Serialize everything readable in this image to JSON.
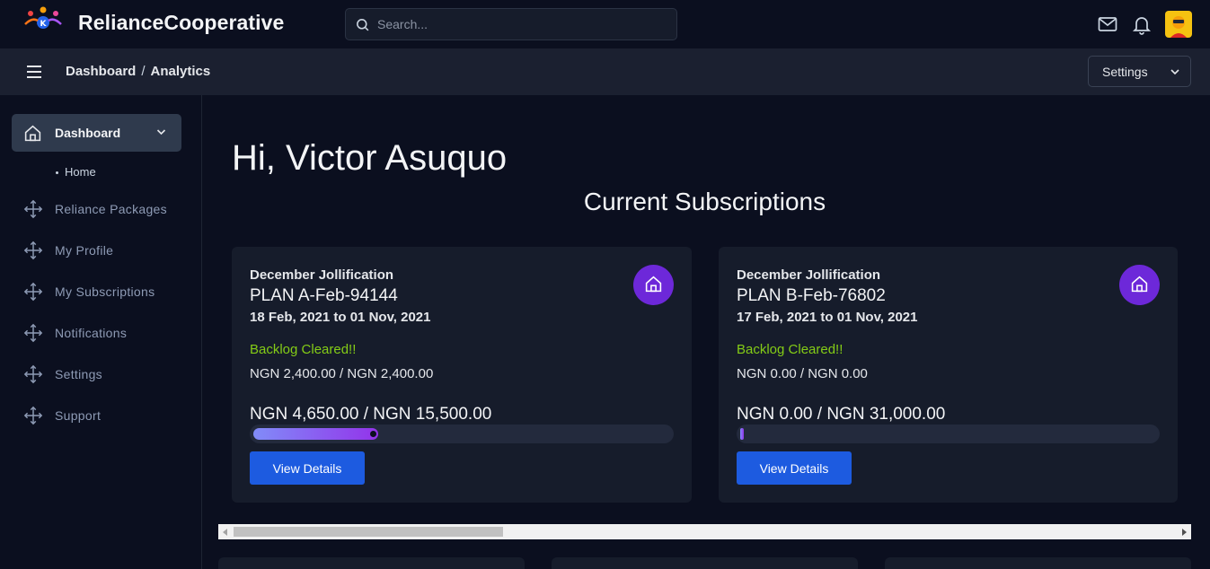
{
  "header": {
    "brand": "RelianceCooperative",
    "search_placeholder": "Search...",
    "icons": [
      "logo-icon",
      "search-icon",
      "mail-icon",
      "bell-icon",
      "avatar"
    ]
  },
  "subheader": {
    "breadcrumb": [
      "Dashboard",
      "Analytics"
    ],
    "settings_label": "Settings"
  },
  "sidebar": {
    "active": {
      "label": "Dashboard",
      "sub_items": [
        "Home"
      ]
    },
    "items": [
      {
        "label": "Reliance Packages"
      },
      {
        "label": "My Profile"
      },
      {
        "label": "My Subscriptions"
      },
      {
        "label": "Notifications"
      },
      {
        "label": "Settings"
      },
      {
        "label": "Support"
      }
    ]
  },
  "main": {
    "greeting": "Hi, Victor Asuquo",
    "section_title": "Current Subscriptions",
    "cards": [
      {
        "name": "December Jollification",
        "plan": "PLAN A-Feb-94144",
        "dates": "18 Feb, 2021 to 01 Nov, 2021",
        "status": "Backlog Cleared!!",
        "backlog": "NGN 2,400.00 / NGN 2,400.00",
        "progress_text": "NGN 4,650.00 / NGN 15,500.00",
        "progress_percent": 30,
        "button": "View Details"
      },
      {
        "name": "December Jollification",
        "plan": "PLAN B-Feb-76802",
        "dates": "17 Feb, 2021 to 01 Nov, 2021",
        "status": "Backlog Cleared!!",
        "backlog": "NGN 0.00 / NGN 0.00",
        "progress_text": "NGN 0.00 / NGN 31,000.00",
        "progress_percent": 0,
        "button": "View Details"
      }
    ]
  },
  "colors": {
    "background": "#0b0f1f",
    "card": "#161c2b",
    "accent_purple": "#6d28d9",
    "button_blue": "#1d5be0",
    "success_green": "#84cc16"
  }
}
